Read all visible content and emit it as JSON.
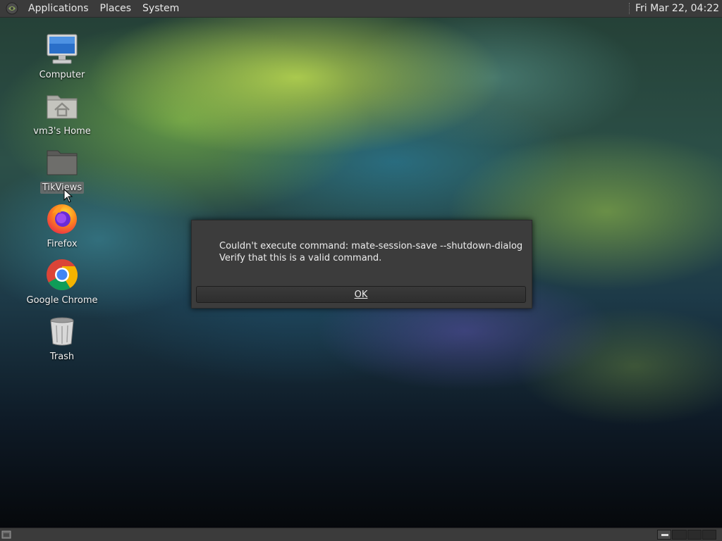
{
  "top_panel": {
    "menus": [
      "Applications",
      "Places",
      "System"
    ],
    "clock": "Fri Mar 22, 04:22"
  },
  "desktop_icons": [
    {
      "label": "Computer",
      "icon": "computer-icon"
    },
    {
      "label": "vm3's Home",
      "icon": "home-folder-icon"
    },
    {
      "label": "TikViews",
      "icon": "folder-icon",
      "selected": true
    },
    {
      "label": "Firefox",
      "icon": "firefox-icon"
    },
    {
      "label": "Google Chrome",
      "icon": "chrome-icon"
    },
    {
      "label": "Trash",
      "icon": "trash-icon"
    }
  ],
  "dialog": {
    "line1": "Couldn't execute command: mate-session-save --shutdown-dialog",
    "line2": "Verify that this is a valid command.",
    "ok_label": "OK"
  },
  "bottom_panel": {
    "workspaces": 4,
    "active_workspace": 1
  }
}
